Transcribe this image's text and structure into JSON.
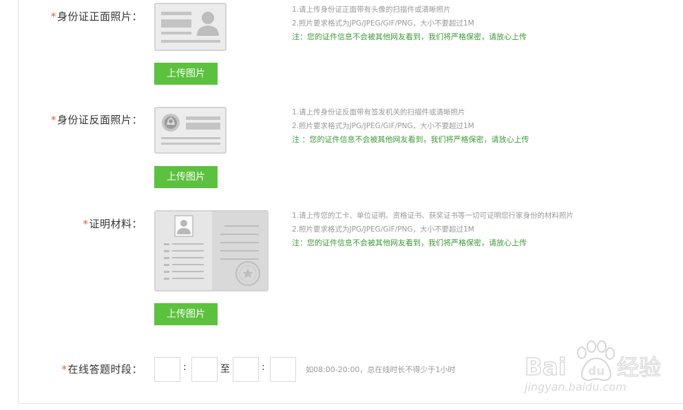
{
  "required_mark": "*",
  "sections": [
    {
      "label": "身份证正面照片：",
      "upload_label": "上传图片",
      "hints": [
        "1.请上传身份证正面带有头像的扫描件或清晰照片",
        "2.照片要求格式为JPG/JPEG/GIF/PNG，大小不要超过1M"
      ],
      "note": "注：您的证件信息不会被其他网友看到，我们将严格保密，请放心上传"
    },
    {
      "label": "身份证反面照片：",
      "upload_label": "上传图片",
      "hints": [
        "1.请上传身份证反面带有签发机关的扫描件或清晰照片",
        "2.照片要求格式为JPG/JPEG/GIF/PNG，大小不要超过1M"
      ],
      "note": "注 ：您的证件信息不会被其他网友看到，我们将严格保密，请放心上传"
    },
    {
      "label": "证明材料：",
      "upload_label": "上传图片",
      "hints": [
        "1.请上传您的工卡、单位证明、资格证书、获奖证书等一切可证明您行家身份的材料照片",
        "2.照片要求格式为JPG/JPEG/GIF/PNG，大小不要超过1M"
      ],
      "note": "注：您的证件信息不会被其他网友看到，我们将严格保密，请放心上传"
    }
  ],
  "online_time": {
    "label": "在线答题时段：",
    "colon": ":",
    "to": "至",
    "hint": "如08:00-20:00，总在线时长不得少于1小时",
    "start_hour": "",
    "start_minute": "",
    "end_hour": "",
    "end_minute": ""
  },
  "watermark": {
    "brand": "Bai",
    "brand_tail": "经验",
    "url": "jingyan.baidu.com"
  },
  "colors": {
    "accent_green": "#5cc13e",
    "note_green": "#3e9a38",
    "required_red": "#e85a2e"
  }
}
